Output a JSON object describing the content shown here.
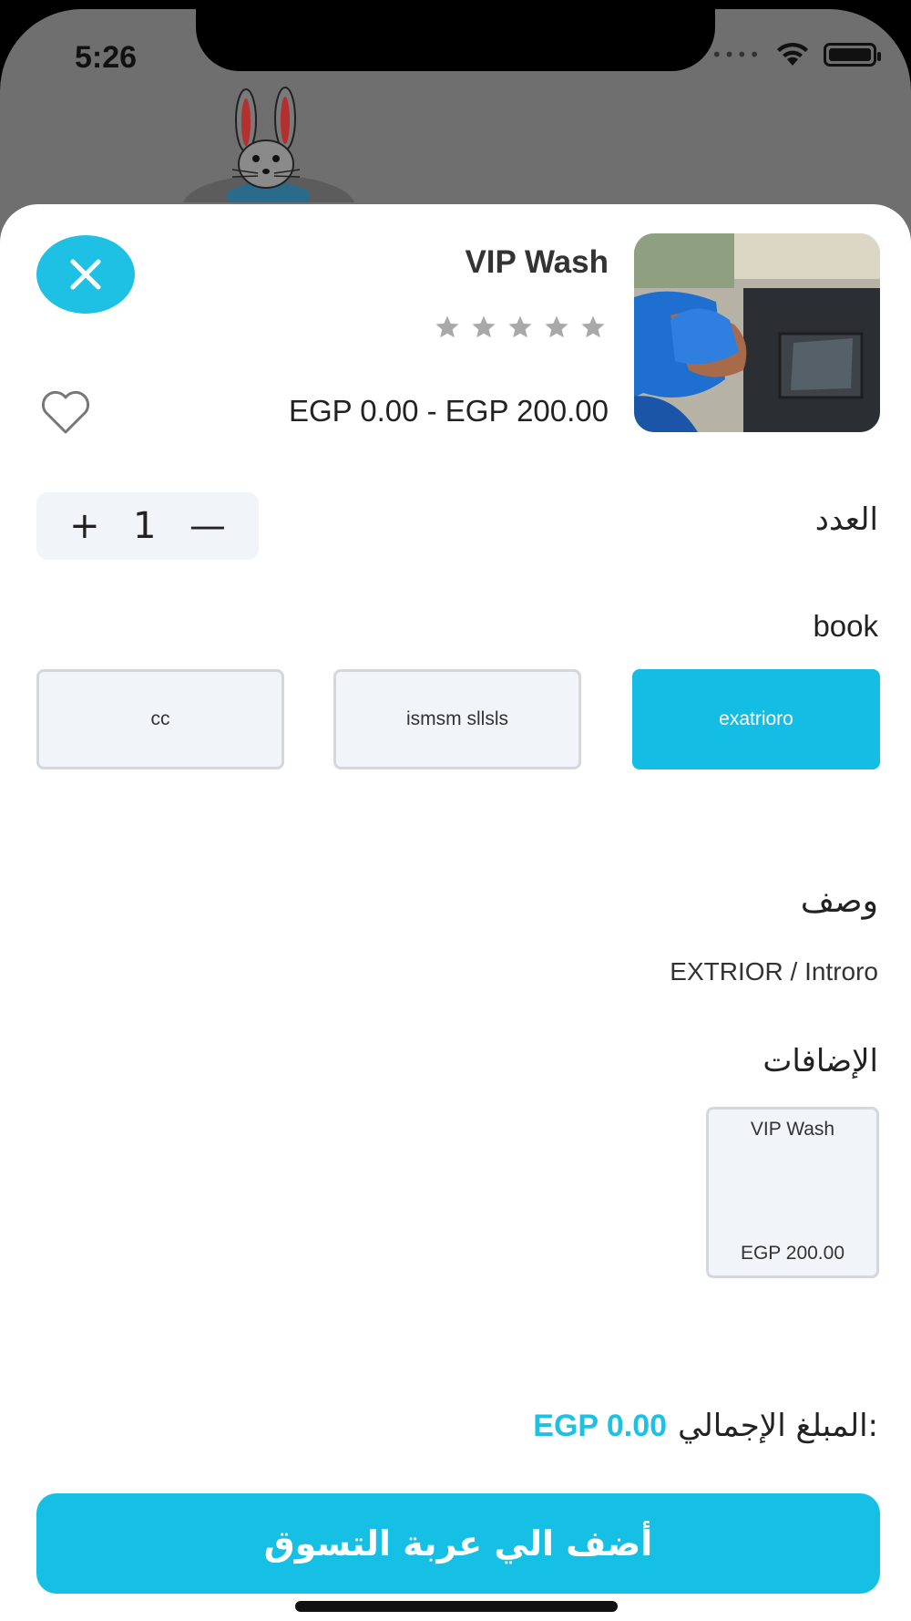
{
  "status_bar": {
    "time": "5:26",
    "signal_dots": "••••",
    "icons": [
      "wifi-icon",
      "battery-icon"
    ]
  },
  "product": {
    "title": "VIP Wash",
    "rating": 0,
    "rating_max": 5,
    "price_range": "EGP 0.00 - EGP 200.00"
  },
  "quantity": {
    "label": "العدد",
    "value": "1",
    "plus_symbol": "+",
    "minus_symbol": "—"
  },
  "book": {
    "label": "book",
    "options": [
      "cc",
      "ismsm sllsls",
      "exatrioro"
    ],
    "selected": "exatrioro"
  },
  "description": {
    "label": "وصف",
    "value": "EXTRIOR / Introro"
  },
  "addons": {
    "label": "الإضافات",
    "items": [
      {
        "name": "VIP Wash",
        "price": "EGP 200.00"
      }
    ]
  },
  "total": {
    "label": "المبلغ الإجمالي:",
    "value": "EGP 0.00"
  },
  "cta": {
    "label": "أضف الي عربة التسوق"
  },
  "colors": {
    "accent": "#1ec0e4",
    "option_bg": "#f1f4f9",
    "star": "#a9a9a9"
  }
}
